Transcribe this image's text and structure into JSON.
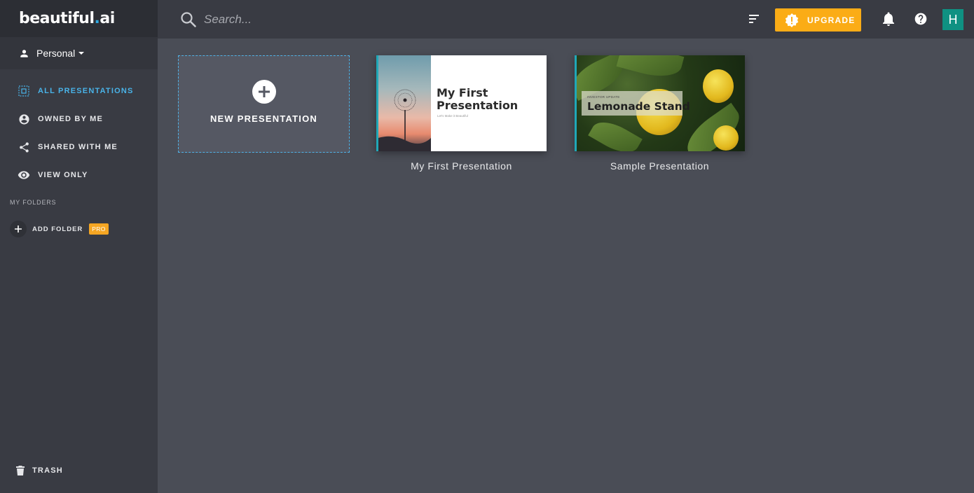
{
  "app": {
    "logo_text": "beautiful",
    "logo_dot": ".",
    "logo_suffix": "ai"
  },
  "sidebar": {
    "workspace": "Personal",
    "nav": [
      {
        "label": "ALL PRESENTATIONS",
        "icon": "all-presentations-icon",
        "active": true
      },
      {
        "label": "OWNED BY ME",
        "icon": "account-circle-icon",
        "active": false
      },
      {
        "label": "SHARED WITH ME",
        "icon": "share-icon",
        "active": false
      },
      {
        "label": "VIEW ONLY",
        "icon": "eye-icon",
        "active": false
      }
    ],
    "folders_label": "MY FOLDERS",
    "add_folder": "ADD FOLDER",
    "pro_badge": "PRO",
    "trash": "TRASH"
  },
  "topbar": {
    "search_placeholder": "Search...",
    "upgrade_label": "UPGRADE",
    "avatar_initial": "H"
  },
  "main": {
    "new_presentation": "NEW PRESENTATION",
    "presentations": [
      {
        "caption": "My First Presentation",
        "slide_title": "My First Presentation",
        "slide_subtitle": "Let's Make it Beautiful"
      },
      {
        "caption": "Sample Presentation",
        "slide_kicker": "INVESTOR UPDATE",
        "slide_title": "Lemonade Stand"
      }
    ]
  },
  "colors": {
    "accent": "#49b3e8",
    "upgrade": "#fbac16",
    "avatar": "#0f9182",
    "sidebar_bg": "#393b43",
    "main_bg": "#4a4d56"
  }
}
